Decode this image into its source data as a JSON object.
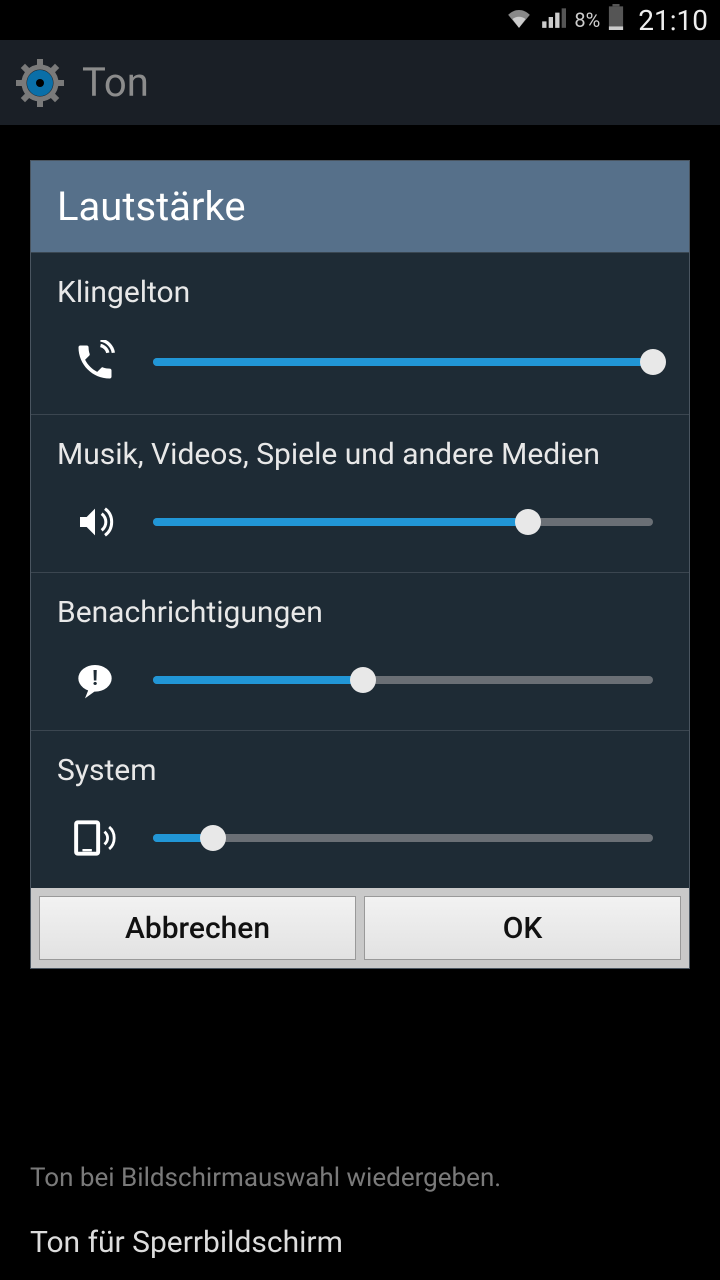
{
  "status": {
    "battery_pct": "8%",
    "time": "21:10"
  },
  "actionbar": {
    "title": "Ton"
  },
  "dialog": {
    "title": "Lautstärke",
    "sections": [
      {
        "label": "Klingelton",
        "value": 100
      },
      {
        "label": "Musik, Videos, Spiele und andere Medien",
        "value": 75
      },
      {
        "label": "Benachrichtigungen",
        "value": 42
      },
      {
        "label": "System",
        "value": 12
      }
    ],
    "cancel": "Abbrechen",
    "ok": "OK"
  },
  "background": {
    "line1": "Ton bei Bildschirmauswahl wiedergeben.",
    "line2": "Ton für Sperrbildschirm"
  }
}
